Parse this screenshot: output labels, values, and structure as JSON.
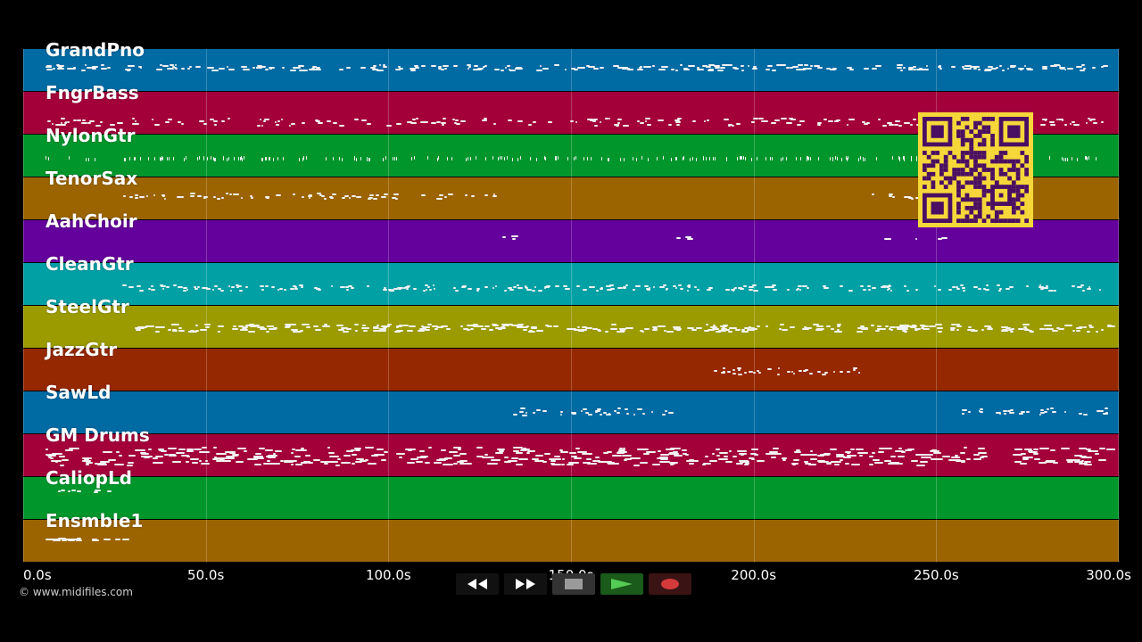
{
  "tracks": [
    {
      "name": "GrandPno",
      "color": "#006aa3"
    },
    {
      "name": "FngrBass",
      "color": "#a3003a"
    },
    {
      "name": "NylonGtr",
      "color": "#00962c"
    },
    {
      "name": "TenorSax",
      "color": "#9b6400"
    },
    {
      "name": "AahChoir",
      "color": "#64009b"
    },
    {
      "name": "CleanGtr",
      "color": "#00a0a5"
    },
    {
      "name": "SteelGtr",
      "color": "#9b9b00"
    },
    {
      "name": "JazzGtr",
      "color": "#962800"
    },
    {
      "name": "SawLd",
      "color": "#006aa3"
    },
    {
      "name": "GM Drums",
      "color": "#a3003a"
    },
    {
      "name": "CaliopLd",
      "color": "#00962c"
    },
    {
      "name": "Ensmble1",
      "color": "#9b6400"
    }
  ],
  "timeline": {
    "duration_seconds": 300,
    "ticks": [
      {
        "seconds": 0,
        "label": "0.0s"
      },
      {
        "seconds": 50,
        "label": "50.0s"
      },
      {
        "seconds": 100,
        "label": "100.0s"
      },
      {
        "seconds": 150,
        "label": "150.0s"
      },
      {
        "seconds": 200,
        "label": "200.0s"
      },
      {
        "seconds": 250,
        "label": "250.0s"
      },
      {
        "seconds": 300,
        "label": "300.0s"
      }
    ]
  },
  "footer": {
    "copyright": "© www.midifiles.com"
  },
  "transport": {
    "buttons": [
      {
        "name": "rewind-button",
        "icon": "rewind-icon",
        "bg": "#111111",
        "fg": "#ffffff"
      },
      {
        "name": "fast-forward-button",
        "icon": "fast-forward-icon",
        "bg": "#111111",
        "fg": "#ffffff"
      },
      {
        "name": "stop-button",
        "icon": "stop-icon",
        "bg": "#333333",
        "fg": "#9a9a9a"
      },
      {
        "name": "play-button",
        "icon": "play-icon",
        "bg": "#1a5a1a",
        "fg": "#55cc55"
      },
      {
        "name": "record-button",
        "icon": "record-icon",
        "bg": "#3a1414",
        "fg": "#d43a3a"
      }
    ]
  },
  "overlay": {
    "qr_code": "qr-code-icon",
    "qr_bg": "#f5d73a",
    "qr_fg": "#4a0e63"
  }
}
